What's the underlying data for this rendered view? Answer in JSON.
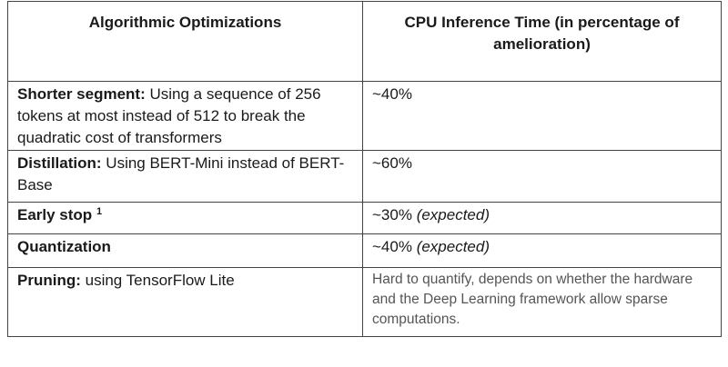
{
  "table": {
    "headers": [
      "Algorithmic Optimizations",
      "CPU Inference Time (in percentage of amelioration)"
    ],
    "rows": [
      {
        "name": "Shorter segment:",
        "desc": " Using a sequence of 256 tokens at most instead of 512 to break the quadratic cost of transformers",
        "value": "~40%",
        "note": ""
      },
      {
        "name": "Distillation:",
        "desc": " Using BERT-Mini instead of BERT-Base",
        "value": "~60%",
        "note": ""
      },
      {
        "name": "Early stop",
        "sup": "1",
        "desc": "",
        "value": "~30%",
        "note": "(expected)"
      },
      {
        "name": "Quantization",
        "desc": "",
        "value": "~40%",
        "note": "(expected)"
      },
      {
        "name": "Pruning:",
        "desc": " using TensorFlow Lite",
        "value": "Hard to quantify, depends on whether the hardware and the Deep Learning framework allow sparse computations.",
        "note": ""
      }
    ]
  }
}
